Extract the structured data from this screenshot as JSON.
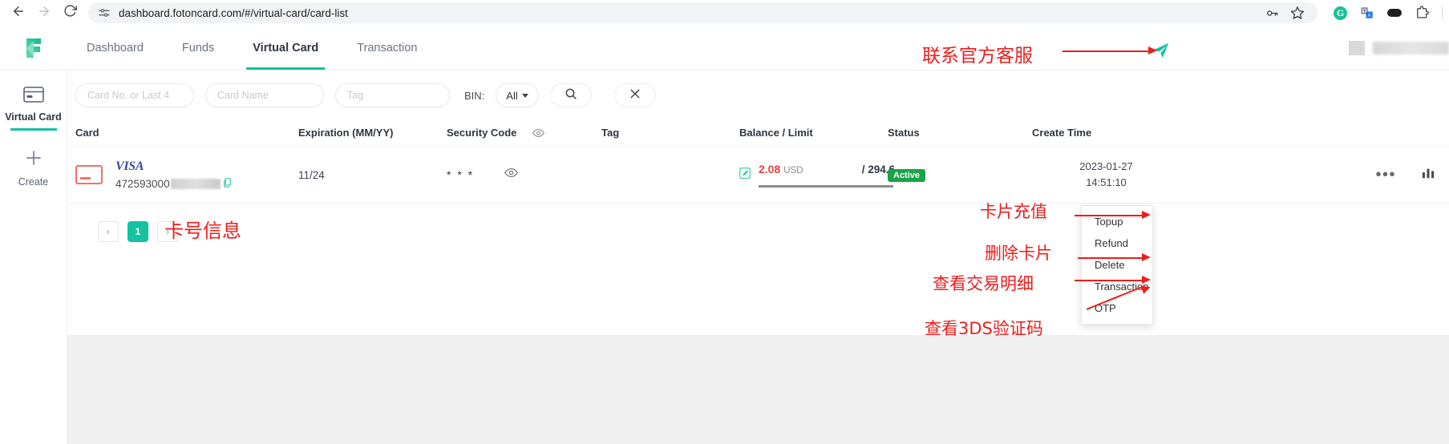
{
  "browser": {
    "url": "dashboard.fotoncard.com/#/virtual-card/card-list",
    "back_icon": "back-arrow-icon",
    "forward_icon": "forward-arrow-icon",
    "reload_icon": "reload-icon",
    "site_settings_icon": "site-settings-icon",
    "password_icon": "key-icon",
    "bookmark_icon": "star-icon",
    "grammarly_icon": "G",
    "translate_icon": "translate-icon",
    "pill_icon": "dark-extension-icon",
    "extensions_icon": "puzzle-piece-icon"
  },
  "header": {
    "logo": "foton-logo",
    "tabs": [
      {
        "label": "Dashboard",
        "active": false
      },
      {
        "label": "Funds",
        "active": false
      },
      {
        "label": "Virtual Card",
        "active": true
      },
      {
        "label": "Transaction",
        "active": false
      }
    ],
    "send_icon": "paper-plane-icon"
  },
  "sidebar": {
    "items": [
      {
        "label": "Virtual Card",
        "icon": "credit-card-icon",
        "active": true
      },
      {
        "label": "Create",
        "icon": "plus-icon",
        "active": false
      }
    ]
  },
  "filters": {
    "card_no_placeholder": "Card No. or Last 4",
    "card_no_value": "",
    "card_name_placeholder": "Card Name",
    "card_name_value": "",
    "tag_placeholder": "Tag",
    "tag_value": "",
    "bin_label": "BIN:",
    "bin_value": "All",
    "bin_options": [
      "All"
    ],
    "search_icon": "search-icon",
    "clear_icon": "close-icon"
  },
  "table": {
    "columns": [
      "Card",
      "Expiration (MM/YY)",
      "Security Code",
      "Tag",
      "Balance / Limit",
      "Status",
      "Create Time"
    ],
    "security_toggle_icon": "eye-icon",
    "rows": [
      {
        "brand": "VISA",
        "card_number": "472593000",
        "expiration": "11/24",
        "security_code": "* * *",
        "security_eye_icon": "eye-icon",
        "tag": "",
        "tag_edit_icon": "edit-icon",
        "balance": "2.08",
        "currency": "USD",
        "limit": "/ 294.6",
        "status": "Active",
        "create_date": "2023-01-27",
        "create_time": "14:51:10",
        "more_icon": "ellipsis-icon",
        "chart_icon": "bar-chart-icon"
      }
    ]
  },
  "pagination": {
    "prev": "‹",
    "pages": [
      "1"
    ],
    "next": "›",
    "current": "1"
  },
  "context_menu": {
    "items": [
      "Topup",
      "Refund",
      "Delete",
      "Transaction",
      "OTP"
    ]
  },
  "annotations": [
    {
      "text": "联系官方客服"
    },
    {
      "text": "卡号信息"
    },
    {
      "text": "卡片充值"
    },
    {
      "text": "删除卡片"
    },
    {
      "text": "查看交易明细"
    },
    {
      "text": "查看3DS验证码"
    }
  ],
  "colors": {
    "accent": "#13c2a0",
    "danger": "#e8403a",
    "success": "#1aa349",
    "annotation": "#ee1c1c",
    "visa": "#3a4a9e"
  }
}
